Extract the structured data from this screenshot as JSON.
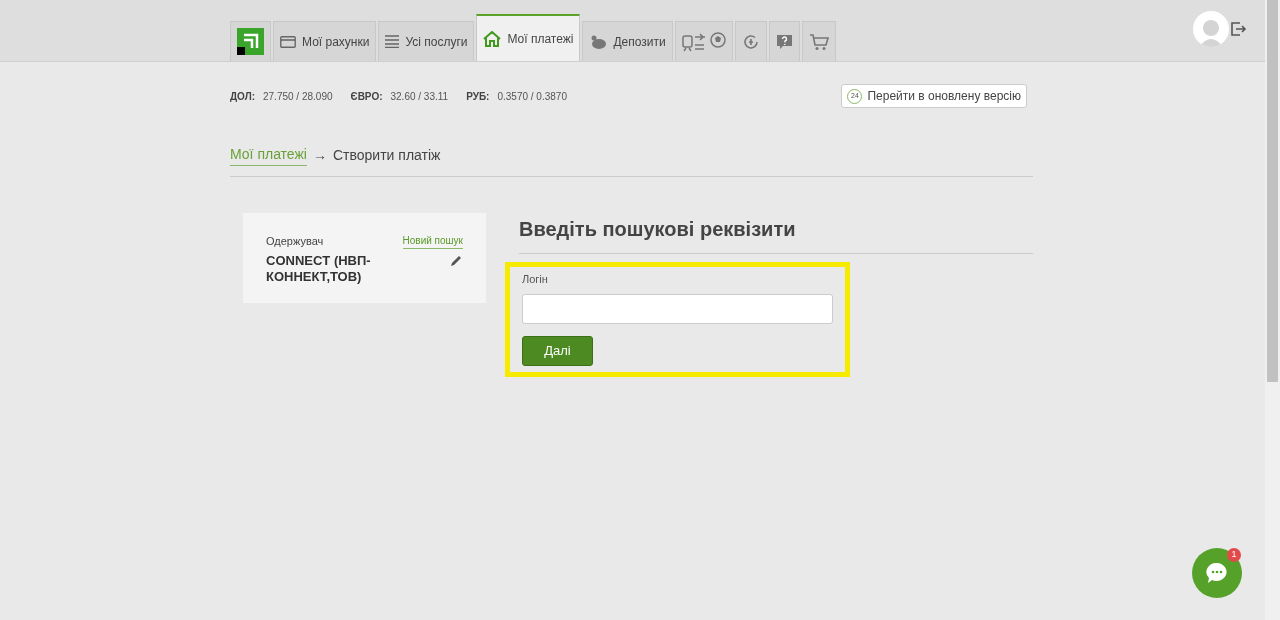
{
  "tabs": [
    {
      "kind": "logo",
      "selected": false
    },
    {
      "kind": "text",
      "label": "Мої рахунки",
      "selected": false
    },
    {
      "kind": "text",
      "label": "Усі послуги",
      "selected": false
    },
    {
      "kind": "text",
      "label": "Мої платежі",
      "selected": true
    },
    {
      "kind": "text",
      "label": "Депозити",
      "selected": false
    },
    {
      "kind": "icon",
      "selected": false
    },
    {
      "kind": "icon",
      "selected": false
    },
    {
      "kind": "icon",
      "selected": false
    },
    {
      "kind": "icon",
      "selected": false
    }
  ],
  "rates": [
    {
      "label": "ДОЛ:",
      "value": "27.750 / 28.090"
    },
    {
      "label": "ЄВРО:",
      "value": "32.60 / 33.11"
    },
    {
      "label": "РУБ:",
      "value": "0.3570 / 0.3870"
    }
  ],
  "new_version_button": {
    "badge": "24",
    "label": "Перейти в оновлену версію"
  },
  "breadcrumb": {
    "link": "Мої платежі",
    "separator": "→",
    "current": "Створити платіж"
  },
  "recipient": {
    "label": "Одержувач",
    "action": "Новий пошук",
    "name": "CONNECT (НВП-КОННЕКТ,ТОВ)"
  },
  "form": {
    "title": "Введіть пошукові реквізити",
    "field_label": "Логін",
    "highlighted": true,
    "submit": "Далі"
  },
  "chat": {
    "badge": "1"
  }
}
